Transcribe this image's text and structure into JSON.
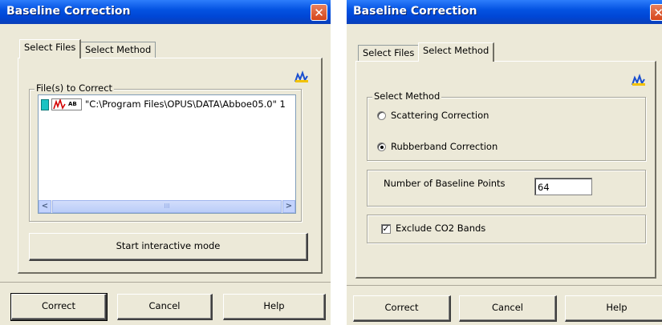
{
  "left_dialog": {
    "title": "Baseline Correction",
    "close_glyph": "✕",
    "tabs": [
      {
        "label": "Select Files",
        "active": true
      },
      {
        "label": "Select Method",
        "active": false
      }
    ],
    "app_icon": "spectrum-icon",
    "files_group_label": "File(s) to Correct",
    "file_badge": "AB",
    "file_item": "\"C:\\Program Files\\OPUS\\DATA\\Abboe05.0\" 1",
    "scroll_left_glyph": "<",
    "scroll_right_glyph": ">",
    "scroll_grip": "III",
    "start_interactive_label": "Start interactive mode",
    "buttons": {
      "correct": "Correct",
      "cancel": "Cancel",
      "help": "Help"
    }
  },
  "right_dialog": {
    "title": "Baseline Correction",
    "close_glyph": "✕",
    "tabs": [
      {
        "label": "Select Files",
        "active": false
      },
      {
        "label": "Select Method",
        "active": true
      }
    ],
    "app_icon": "spectrum-icon",
    "method_group_label": "Select Method",
    "methods": [
      {
        "label": "Scattering Correction",
        "selected": false
      },
      {
        "label": "Rubberband Correction",
        "selected": true
      }
    ],
    "baseline_points_label": "Number of Baseline Points",
    "baseline_points_value": "64",
    "exclude_co2_label": "Exclude CO2 Bands",
    "exclude_co2_checked": true,
    "check_glyph": "✓",
    "buttons": {
      "correct": "Correct",
      "cancel": "Cancel",
      "help": "Help"
    }
  },
  "colors": {
    "titlebar": "#0453e2",
    "dialog_bg": "#ece9d8",
    "close_button": "#d6451a",
    "scrollbar": "#c3d3fd"
  }
}
